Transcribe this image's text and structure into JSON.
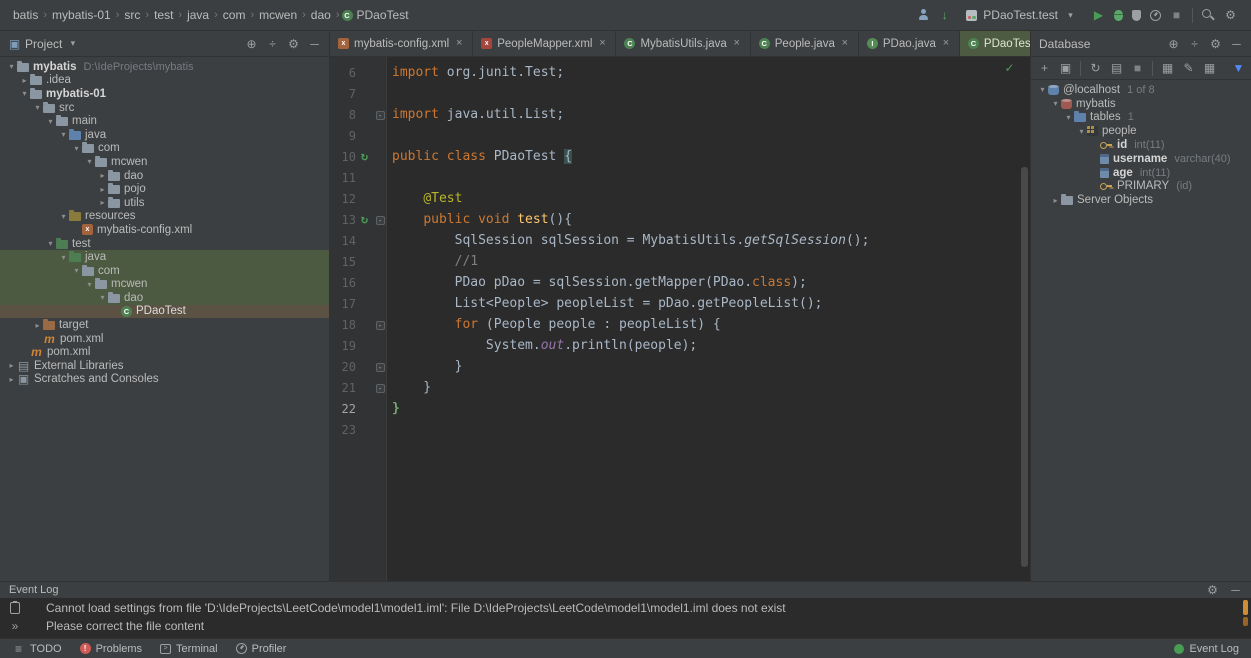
{
  "colors": {
    "bg_editor": "#2b2b2b",
    "bg_panel": "#3c3f41",
    "border": "#323232",
    "accent_green": "#499c54",
    "keyword_orange": "#cc7832",
    "code_text": "#a9b7c6",
    "line_number": "#606366",
    "tab_active_bg": "#4c5b41",
    "tree_test_row_bg": "#4b5a40",
    "tree_selected_row_bg": "#5c5244",
    "annotation_yellow": "#bbb529",
    "comment_gray": "#808080",
    "field_purple": "#9876aa",
    "method_yellow": "#ffc66d",
    "error_stripe_orange": "#cf8e36"
  },
  "breadcrumbs": {
    "items": [
      "batis",
      "mybatis-01",
      "src",
      "test",
      "java",
      "com",
      "mcwen",
      "dao",
      "PDaoTest"
    ],
    "last_icon": "test-class-icon"
  },
  "toolbar": {
    "icons_pre": [
      "vcs-user-icon",
      "vcs-update-icon"
    ],
    "run_config_label": "PDaoTest.test",
    "icons_post": [
      "run-icon",
      "debug-icon",
      "coverage-icon",
      "profiler-icon",
      "stop-icon",
      "separator",
      "search-icon",
      "settings-icon"
    ]
  },
  "project_panel": {
    "title": "Project",
    "header_icons": [
      "locate-icon",
      "collapse-all-icon",
      "settings-icon",
      "hide-icon"
    ],
    "tree": [
      {
        "level": 0,
        "arrow": "open",
        "icon": "folder-project-icon",
        "label": "mybatis",
        "bold": true,
        "suffix": "D:\\IdeProjects\\mybatis"
      },
      {
        "level": 1,
        "arrow": "closed",
        "icon": "folder-icon",
        "label": ".idea"
      },
      {
        "level": 1,
        "arrow": "open",
        "icon": "folder-project-icon",
        "label": "mybatis-01",
        "bold": true
      },
      {
        "level": 2,
        "arrow": "open",
        "icon": "folder-icon",
        "label": "src"
      },
      {
        "level": 3,
        "arrow": "open",
        "icon": "folder-icon",
        "label": "main"
      },
      {
        "level": 4,
        "arrow": "open",
        "icon": "folder-src-icon",
        "label": "java"
      },
      {
        "level": 5,
        "arrow": "open",
        "icon": "folder-pkg-icon",
        "label": "com"
      },
      {
        "level": 6,
        "arrow": "open",
        "icon": "folder-pkg-icon",
        "label": "mcwen"
      },
      {
        "level": 7,
        "arrow": "closed",
        "icon": "folder-pkg-icon",
        "label": "dao"
      },
      {
        "level": 7,
        "arrow": "closed",
        "icon": "folder-pkg-icon",
        "label": "pojo"
      },
      {
        "level": 7,
        "arrow": "closed",
        "icon": "folder-pkg-icon",
        "label": "utils"
      },
      {
        "level": 4,
        "arrow": "open",
        "icon": "folder-res-icon",
        "label": "resources"
      },
      {
        "level": 5,
        "icon": "xml-file-icon",
        "label": "mybatis-config.xml"
      },
      {
        "level": 3,
        "arrow": "open",
        "icon": "folder-test-icon",
        "label": "test"
      },
      {
        "level": 4,
        "arrow": "open",
        "icon": "folder-test-icon",
        "label": "java",
        "rowbg": "test"
      },
      {
        "level": 5,
        "arrow": "open",
        "icon": "folder-pkg-icon",
        "label": "com",
        "rowbg": "test"
      },
      {
        "level": 6,
        "arrow": "open",
        "icon": "folder-pkg-icon",
        "label": "mcwen",
        "rowbg": "test"
      },
      {
        "level": 7,
        "arrow": "open",
        "icon": "folder-pkg-icon",
        "label": "dao",
        "rowbg": "test"
      },
      {
        "level": 8,
        "icon": "test-class-icon",
        "label": "PDaoTest",
        "rowbg": "selected"
      },
      {
        "level": 2,
        "arrow": "closed",
        "icon": "folder-excl-icon",
        "label": "target"
      },
      {
        "level": 2,
        "icon": "maven-icon",
        "label": "pom.xml"
      },
      {
        "level": 1,
        "icon": "maven-icon",
        "label": "pom.xml"
      },
      {
        "level": 0,
        "arrow": "closed",
        "icon": "libs-icon",
        "label": "External Libraries"
      },
      {
        "level": 0,
        "arrow": "closed",
        "icon": "scratches-icon",
        "label": "Scratches and Consoles"
      }
    ]
  },
  "tabs": {
    "items": [
      {
        "icon": "xml-file-icon",
        "label": "mybatis-config.xml"
      },
      {
        "icon": "mapper-file-icon",
        "label": "PeopleMapper.xml"
      },
      {
        "icon": "java-class-icon",
        "label": "MybatisUtils.java"
      },
      {
        "icon": "java-class-icon",
        "label": "People.java"
      },
      {
        "icon": "java-interface-icon",
        "label": "PDao.java"
      },
      {
        "icon": "test-class-icon",
        "label": "PDaoTest.java",
        "active": true
      }
    ],
    "overflow_icon": "chevron-down-icon"
  },
  "editor": {
    "inspection_icon": "check-icon",
    "lines": [
      {
        "num": "6",
        "tokens": [
          [
            "kw",
            "import"
          ],
          [
            "pl",
            " org.junit.Test;"
          ]
        ]
      },
      {
        "num": "7",
        "tokens": []
      },
      {
        "num": "8",
        "fold": true,
        "tokens": [
          [
            "kw",
            "import"
          ],
          [
            "pl",
            " java.util.List;"
          ]
        ]
      },
      {
        "num": "9",
        "tokens": []
      },
      {
        "num": "10",
        "run": true,
        "tokens": [
          [
            "kw",
            "public class"
          ],
          [
            "pl",
            " PDaoTest "
          ],
          [
            "br",
            "{"
          ]
        ]
      },
      {
        "num": "11",
        "tokens": []
      },
      {
        "num": "12",
        "tokens": [
          [
            "pl",
            "    "
          ],
          [
            "ann",
            "@Test"
          ]
        ]
      },
      {
        "num": "13",
        "run": true,
        "fold": true,
        "tokens": [
          [
            "pl",
            "    "
          ],
          [
            "kw",
            "public void "
          ],
          [
            "mth",
            "test"
          ],
          [
            "pl",
            "(){"
          ]
        ]
      },
      {
        "num": "14",
        "tokens": [
          [
            "pl",
            "        SqlSession sqlSession = MybatisUtils."
          ],
          [
            "smi",
            "getSqlSession"
          ],
          [
            "pl",
            "();"
          ]
        ]
      },
      {
        "num": "15",
        "tokens": [
          [
            "pl",
            "        "
          ],
          [
            "cm",
            "//1"
          ]
        ]
      },
      {
        "num": "16",
        "tokens": [
          [
            "pl",
            "        PDao pDao = sqlSession.getMapper(PDao."
          ],
          [
            "kw",
            "class"
          ],
          [
            "pl",
            ");"
          ]
        ]
      },
      {
        "num": "17",
        "tokens": [
          [
            "pl",
            "        List<People> peopleList = pDao.getPeopleList();"
          ]
        ]
      },
      {
        "num": "18",
        "fold": true,
        "tokens": [
          [
            "pl",
            "        "
          ],
          [
            "kw",
            "for"
          ],
          [
            "pl",
            " (People people : peopleList) {"
          ]
        ]
      },
      {
        "num": "19",
        "tokens": [
          [
            "pl",
            "            System."
          ],
          [
            "fld",
            "out"
          ],
          [
            "pl",
            ".println(people);"
          ]
        ]
      },
      {
        "num": "20",
        "fold": true,
        "tokens": [
          [
            "pl",
            "        }"
          ]
        ]
      },
      {
        "num": "21",
        "fold": true,
        "tokens": [
          [
            "pl",
            "    }"
          ]
        ]
      },
      {
        "num": "22",
        "caret": true,
        "tokens": [
          [
            "grn",
            "}"
          ]
        ]
      },
      {
        "num": "23",
        "tokens": []
      }
    ]
  },
  "database_panel": {
    "title": "Database",
    "header_icons": [
      "locate-icon",
      "collapse-all-icon",
      "settings-icon",
      "hide-icon"
    ],
    "toolbar_icons": [
      "add-icon",
      "duplicate-icon",
      "separator",
      "sync-icon",
      "console-icon",
      "stop-icon",
      "separator",
      "table-icon",
      "edit-icon",
      "diagram-icon",
      "spacer",
      "filter-icon"
    ],
    "tree": [
      {
        "level": 0,
        "arrow": "open",
        "icon": "datasource-icon",
        "label": "@localhost",
        "suffix": "1 of 8"
      },
      {
        "level": 1,
        "arrow": "open",
        "icon": "schema-icon",
        "label": "mybatis"
      },
      {
        "level": 2,
        "arrow": "open",
        "icon": "tables-icon",
        "label": "tables",
        "suffix": "1"
      },
      {
        "level": 3,
        "arrow": "open",
        "icon": "table-grid-icon",
        "label": "people"
      },
      {
        "level": 4,
        "icon": "primary-column-icon",
        "label": "id",
        "bold": true,
        "suffix": "int(11)"
      },
      {
        "level": 4,
        "icon": "column-icon",
        "label": "username",
        "bold": true,
        "suffix": "varchar(40)"
      },
      {
        "level": 4,
        "icon": "column-icon",
        "label": "age",
        "bold": true,
        "suffix": "int(11)"
      },
      {
        "level": 4,
        "icon": "key-icon",
        "label": "PRIMARY",
        "suffix": "(id)"
      },
      {
        "level": 1,
        "arrow": "closed",
        "icon": "folder-icon",
        "label": "Server Objects"
      }
    ]
  },
  "event_log": {
    "title": "Event Log",
    "header_icons": [
      "settings-icon",
      "hide-icon"
    ],
    "strip_icons": [
      "notification-icon",
      "expand-icon"
    ],
    "messages": [
      "Cannot load settings from file 'D:\\IdeProjects\\LeetCode\\model1\\model1.iml': File D:\\IdeProjects\\LeetCode\\model1\\model1.iml does not exist",
      "Please correct the file content"
    ]
  },
  "status_bar": {
    "left": [
      {
        "icon": "todo-icon",
        "label": "TODO"
      },
      {
        "icon": "problems-icon",
        "label": "Problems"
      },
      {
        "icon": "terminal-icon",
        "label": "Terminal"
      },
      {
        "icon": "profiler-icon",
        "label": "Profiler"
      }
    ],
    "right": [
      {
        "icon": "eventlog-status-icon",
        "label": "Event Log"
      }
    ]
  }
}
